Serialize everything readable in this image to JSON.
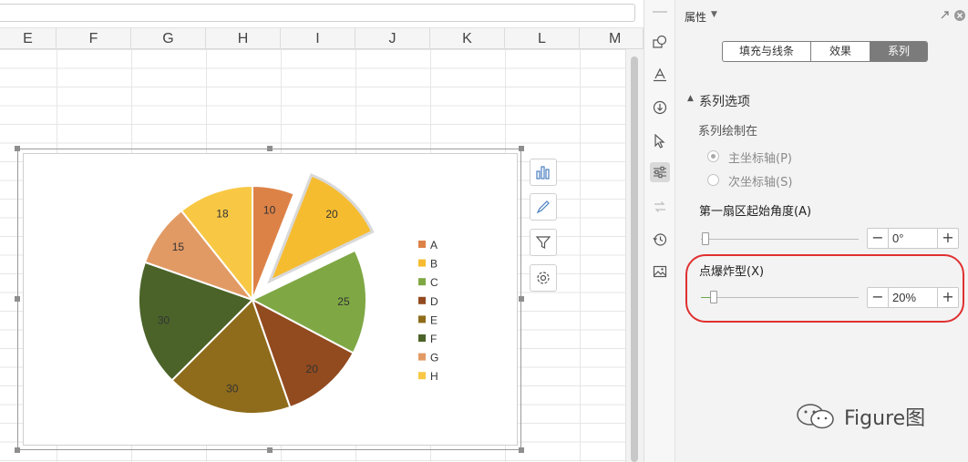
{
  "sheet": {
    "columns": [
      "E",
      "F",
      "G",
      "H",
      "I",
      "J",
      "K",
      "L",
      "M"
    ]
  },
  "chart_data": {
    "type": "pie",
    "categories": [
      "A",
      "B",
      "C",
      "D",
      "E",
      "F",
      "G",
      "H"
    ],
    "values": [
      10,
      20,
      25,
      20,
      30,
      30,
      15,
      18
    ],
    "colors": [
      "#DD8247",
      "#F6BC30",
      "#7FA845",
      "#924A1F",
      "#8F6C1B",
      "#4B6328",
      "#E29A65",
      "#F8C845"
    ],
    "exploded_category": "B",
    "data_labels": [
      "10",
      "20",
      "25",
      "20",
      "30",
      "30",
      "15",
      "18"
    ],
    "legend_position": "right"
  },
  "chart_tools": {
    "icons": [
      "chart-elements-icon",
      "chart-style-icon",
      "chart-filter-icon",
      "chart-settings-icon"
    ]
  },
  "panel": {
    "title": "属性",
    "tabs": [
      {
        "label": "填充与线条",
        "active": false
      },
      {
        "label": "效果",
        "active": false
      },
      {
        "label": "系列",
        "active": true
      }
    ],
    "section_title": "系列选项",
    "plot_on_label": "系列绘制在",
    "radio_primary": "主坐标轴(P)",
    "radio_secondary": "次坐标轴(S)",
    "first_slice_angle_label": "第一扇区起始角度(A)",
    "first_slice_angle_value": "0°",
    "explosion_label": "点爆炸型(X)",
    "explosion_value": "20%",
    "minus": "−",
    "plus": "+"
  },
  "strip_icons": [
    "shape-icon",
    "text-style-icon",
    "fill-icon",
    "select-icon",
    "series-options-icon",
    "swap-icon",
    "history-icon",
    "image-icon"
  ],
  "watermark": "Figure图",
  "accent_color": "#e03030"
}
